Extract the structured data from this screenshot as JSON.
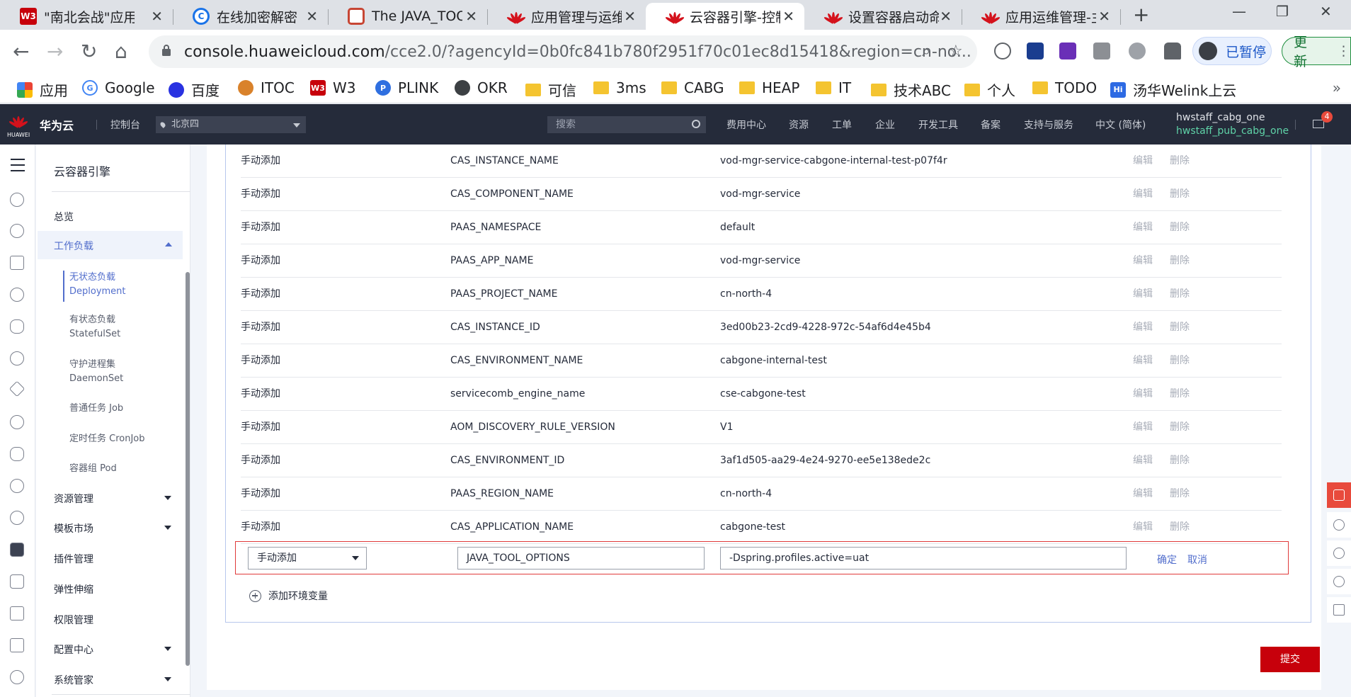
{
  "browser": {
    "tabs": [
      {
        "title": "\"南北会战\"应用上",
        "icon": "w3-icon"
      },
      {
        "title": "在线加密解密",
        "icon": "cloud-icon"
      },
      {
        "title": "The JAVA_TOOL",
        "icon": "oracle-icon"
      },
      {
        "title": "应用管理与运维平",
        "icon": "huawei-icon"
      },
      {
        "title": "云容器引擎-控制",
        "icon": "huawei-icon",
        "active": true
      },
      {
        "title": "设置容器启动命令",
        "icon": "huawei-icon"
      },
      {
        "title": "应用运维管理-主",
        "icon": "huawei-icon"
      }
    ],
    "url_host": "console.huaweicloud.com",
    "url_path": "/cce2.0/?agencyId=0b0fc841b780f2951f70c01ec8d15418&region=cn-no...",
    "paused_label": "已暂停",
    "update_label": "更新",
    "bookmarks": [
      "应用",
      "Google",
      "百度",
      "ITOC",
      "W3",
      "PLINK",
      "OKR",
      "可信",
      "3ms",
      "CABG",
      "HEAP",
      "IT",
      "技术ABC",
      "个人",
      "TODO",
      "汤华Welink上云"
    ]
  },
  "console": {
    "brand": "华为云",
    "logo_text": "HUAWEI",
    "control_panel": "控制台",
    "region": "北京四",
    "search_placeholder": "搜索",
    "nav": [
      "费用中心",
      "资源",
      "工单",
      "企业",
      "开发工具",
      "备案",
      "支持与服务",
      "中文 (简体)"
    ],
    "user_name": "hwstaff_cabg_one",
    "user_account": "hwstaff_pub_cabg_one",
    "mail_count": "4"
  },
  "sidebar": {
    "title": "云容器引擎",
    "overview": "总览",
    "workload": "工作负载",
    "sub": [
      {
        "cn": "无状态负载",
        "en": "Deployment"
      },
      {
        "cn": "有状态负载",
        "en": "StatefulSet"
      },
      {
        "cn": "守护进程集",
        "en": "DaemonSet"
      },
      {
        "cn": "普通任务 Job",
        "en": ""
      },
      {
        "cn": "定时任务 CronJob",
        "en": ""
      },
      {
        "cn": "容器组 Pod",
        "en": ""
      }
    ],
    "items": [
      "资源管理",
      "模板市场",
      "插件管理",
      "弹性伸缩",
      "权限管理",
      "配置中心",
      "系统管家"
    ]
  },
  "env": {
    "rows": [
      {
        "type": "手动添加",
        "name": "CAS_INSTANCE_NAME",
        "value": "vod-mgr-service-cabgone-internal-test-p07f4r"
      },
      {
        "type": "手动添加",
        "name": "CAS_COMPONENT_NAME",
        "value": "vod-mgr-service"
      },
      {
        "type": "手动添加",
        "name": "PAAS_NAMESPACE",
        "value": "default"
      },
      {
        "type": "手动添加",
        "name": "PAAS_APP_NAME",
        "value": "vod-mgr-service"
      },
      {
        "type": "手动添加",
        "name": "PAAS_PROJECT_NAME",
        "value": "cn-north-4"
      },
      {
        "type": "手动添加",
        "name": "CAS_INSTANCE_ID",
        "value": "3ed00b23-2cd9-4228-972c-54af6d4e45b4"
      },
      {
        "type": "手动添加",
        "name": "CAS_ENVIRONMENT_NAME",
        "value": "cabgone-internal-test"
      },
      {
        "type": "手动添加",
        "name": "servicecomb_engine_name",
        "value": "cse-cabgone-test"
      },
      {
        "type": "手动添加",
        "name": "AOM_DISCOVERY_RULE_VERSION",
        "value": "V1"
      },
      {
        "type": "手动添加",
        "name": "CAS_ENVIRONMENT_ID",
        "value": "3af1d505-aa29-4e24-9270-ee5e138ede2c"
      },
      {
        "type": "手动添加",
        "name": "PAAS_REGION_NAME",
        "value": "cn-north-4"
      },
      {
        "type": "手动添加",
        "name": "CAS_APPLICATION_NAME",
        "value": "cabgone-test"
      }
    ],
    "edit_label": "编辑",
    "delete_label": "删除",
    "editing": {
      "type": "手动添加",
      "name": "JAVA_TOOL_OPTIONS",
      "value": "-Dspring.profiles.active=uat",
      "confirm": "确定",
      "cancel": "取消"
    },
    "add_label": "添加环境变量",
    "submit_label": "提交"
  }
}
